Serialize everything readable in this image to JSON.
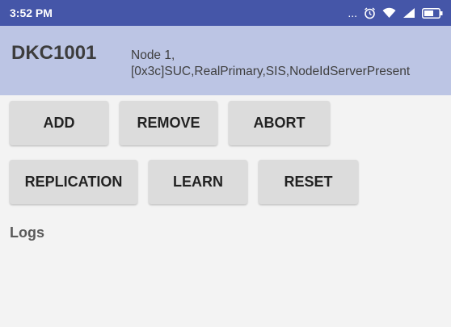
{
  "status_bar": {
    "time": "3:52 PM",
    "more": "...",
    "icons": [
      "alarm-icon",
      "wifi-icon",
      "signal-icon",
      "battery-icon"
    ]
  },
  "header": {
    "device_name": "DKC1001",
    "node_info": "Node 1,\n[0x3c]SUC,RealPrimary,SIS,NodeIdServerPresent"
  },
  "buttons": {
    "add": "ADD",
    "remove": "REMOVE",
    "abort": "ABORT",
    "replication": "REPLICATION",
    "learn": "LEARN",
    "reset": "RESET"
  },
  "logs": {
    "label": "Logs"
  },
  "colors": {
    "status_bar": "#4556a8",
    "header": "#bcc5e4",
    "button": "#dcdcdc",
    "background": "#f3f3f3"
  }
}
